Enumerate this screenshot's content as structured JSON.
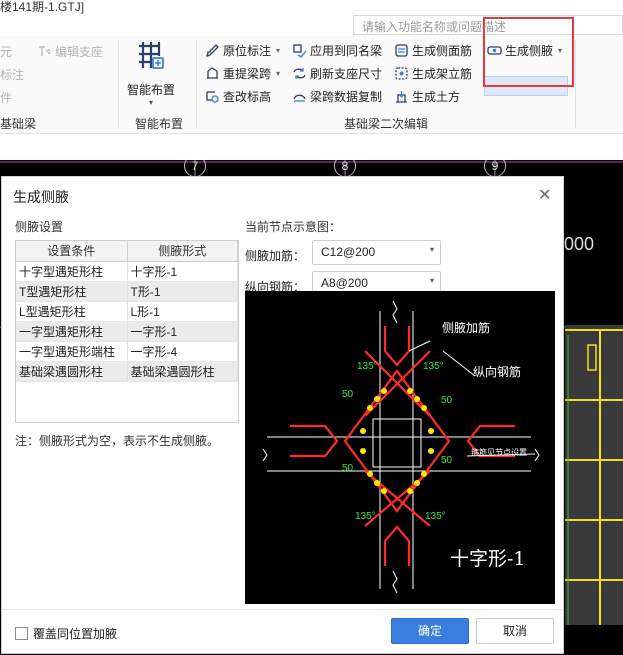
{
  "title_partial": "楼141期-1.GTJ]",
  "search_placeholder": "请输入功能名称或问题描述",
  "ribbon": {
    "left_items": [
      "元",
      "标注",
      "件",
      "基础梁"
    ],
    "disabled_item": "编辑支座",
    "smart_label": "智能布置",
    "smart_group": "智能布置",
    "group2_label": "基础梁二次编辑",
    "col1": [
      "原位标注",
      "重提梁跨",
      "查改标高"
    ],
    "col2": [
      "应用到同名梁",
      "刷新支座尺寸",
      "梁跨数据复制"
    ],
    "col3": [
      "生成侧面筋",
      "生成架立筋",
      "生成土方"
    ],
    "col4": "生成侧腋"
  },
  "cad": {
    "axes": [
      "7",
      "8",
      "9"
    ],
    "partial_number": "000"
  },
  "dialog": {
    "title": "生成侧腋",
    "left_section": "侧腋设置",
    "headers": [
      "设置条件",
      "侧腋形式"
    ],
    "rows": [
      [
        "十字型遇矩形柱",
        "十字形-1"
      ],
      [
        "T型遇矩形柱",
        "T形-1"
      ],
      [
        "L型遇矩形柱",
        "L形-1"
      ],
      [
        "一字型遇矩形柱",
        "一字形-1"
      ],
      [
        "一字型遇矩形端柱",
        "一字形-4"
      ],
      [
        "基础梁遇圆形柱",
        "基础梁遇圆形柱"
      ]
    ],
    "note": "注：侧腋形式为空，表示不生成侧腋。",
    "right_section": "当前节点示意图：",
    "field1_label": "侧腋加筋：",
    "field1_value": "C12@200",
    "field2_label": "纵向钢筋：",
    "field2_value": "A8@200",
    "preview": {
      "label_haunch": "侧腋加筋",
      "label_long": "纵向钢筋",
      "label_note": "箍筋见节点设置",
      "angle": "135°",
      "dim": "50",
      "caption": "十字形-1"
    },
    "checkbox_label": "覆盖同位置加腋",
    "ok_label": "确定",
    "cancel_label": "取消"
  },
  "colors": {
    "accent": "#3a7fe0",
    "highlight_border": "#e23b3b",
    "rebar_red": "#ff2a2a",
    "rebar_yellow": "#ffe600",
    "dim_green": "#36e836"
  }
}
